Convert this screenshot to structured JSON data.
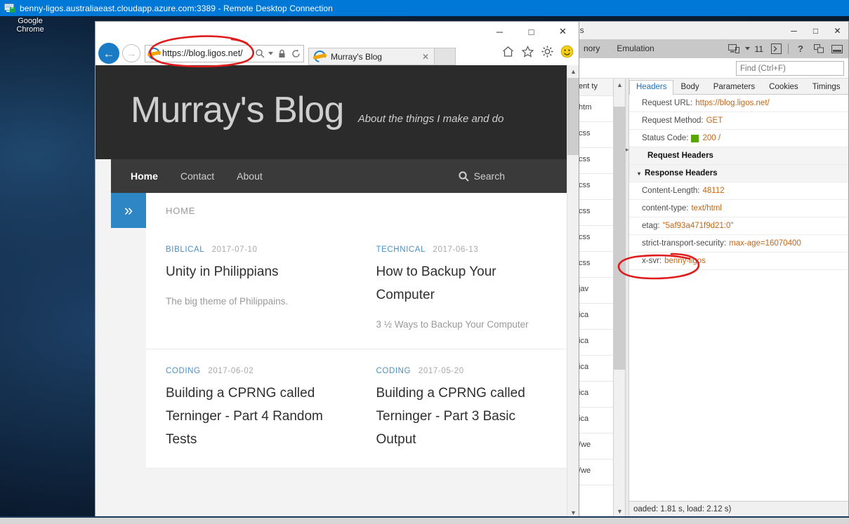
{
  "rdp": {
    "title": "benny-ligos.australiaeast.cloudapp.azure.com:3389 - Remote Desktop Connection",
    "icon": "remote-desktop-icon"
  },
  "desktop": {
    "icon_label": "Google\nChrome",
    "icon_label_line1": "Google",
    "icon_label_line2": "Chrome"
  },
  "browser": {
    "window_title": "",
    "url": "https://blog.ligos.net/",
    "tab_title": "Murray's Blog",
    "back_icon": "back-arrow-icon",
    "forward_icon": "forward-arrow-icon",
    "search_icon": "search-magnifier-icon",
    "dropdown_icon": "chevron-down-icon",
    "lock_icon": "padlock-icon",
    "refresh_icon": "refresh-icon",
    "tab_close_icon": "close-icon",
    "home_icon": "home-icon",
    "favorites_icon": "star-icon",
    "settings_icon": "gear-icon",
    "feedback_icon": "smiley-icon",
    "minimize": "─",
    "maximize": "□",
    "close": "✕"
  },
  "blog": {
    "title": "Murray's Blog",
    "tagline": "About the things I make and do",
    "nav": [
      {
        "label": "Home",
        "active": true
      },
      {
        "label": "Contact",
        "active": false
      },
      {
        "label": "About",
        "active": false
      }
    ],
    "search_label": "Search",
    "breadcrumb": "HOME",
    "sidebar_toggle_icon": "double-chevron-right-icon",
    "posts": [
      {
        "category": "BIBLICAL",
        "date": "2017-07-10",
        "title": "Unity in Philippians",
        "excerpt": "The big theme of Philippains."
      },
      {
        "category": "TECHNICAL",
        "date": "2017-06-13",
        "title": "How to Backup Your Computer",
        "excerpt": "3 ½ Ways to Backup Your Computer"
      },
      {
        "category": "CODING",
        "date": "2017-06-02",
        "title": "Building a CPRNG called Terninger - Part 4 Random Tests",
        "excerpt": ""
      },
      {
        "category": "CODING",
        "date": "2017-05-20",
        "title": "Building a CPRNG called Terninger - Part 3 Basic Output",
        "excerpt": ""
      }
    ]
  },
  "devtools": {
    "window_title": "ls",
    "menus": [
      "nory",
      "Emulation"
    ],
    "doc_mode_icon": "device-emulation-icon",
    "doc_mode": "11",
    "console_icon": "console-prompt-icon",
    "help_icon": "help-question-icon",
    "copy_icon": "copy-windows-icon",
    "dock_icon": "dock-panel-icon",
    "find_placeholder": "Find (Ctrl+F)",
    "minimize": "─",
    "maximize": "□",
    "close": "✕",
    "network_col_header": "tent ty",
    "network_rows": [
      "/htm",
      "/css",
      "/css",
      "/css",
      "/css",
      "/css",
      "/css",
      "/jav",
      "/ica",
      "/ica",
      "/ica",
      "/ica",
      "/ica",
      "t/we",
      "t/we"
    ],
    "detail_tabs": [
      {
        "label": "Headers",
        "active": true
      },
      {
        "label": "Body",
        "active": false
      },
      {
        "label": "Parameters",
        "active": false
      },
      {
        "label": "Cookies",
        "active": false
      },
      {
        "label": "Timings",
        "active": false
      }
    ],
    "summary": [
      {
        "key": "Request URL:",
        "value": "https://blog.ligos.net/"
      },
      {
        "key": "Request Method:",
        "value": "GET"
      }
    ],
    "status_key": "Status Code:",
    "status_value": "200 /",
    "status_color": "#5aa600",
    "request_headers_label": "Request Headers",
    "response_headers_label": "Response Headers",
    "response_headers": [
      {
        "key": "Content-Length:",
        "value": "48112"
      },
      {
        "key": "content-type:",
        "value": "text/html"
      },
      {
        "key": "etag:",
        "value": "\"5af93a471f9d21:0\""
      },
      {
        "key": "strict-transport-security:",
        "value": "max-age=16070400"
      },
      {
        "key": "x-svr:",
        "value": "benny-ligos"
      }
    ],
    "statusbar": "oaded: 1.81 s, load: 2.12 s)"
  },
  "annotations": {
    "url_circle": "red-circle-annotation-url",
    "xsvr_circle": "red-circle-annotation-xsvr",
    "color": "#e01b1b"
  }
}
